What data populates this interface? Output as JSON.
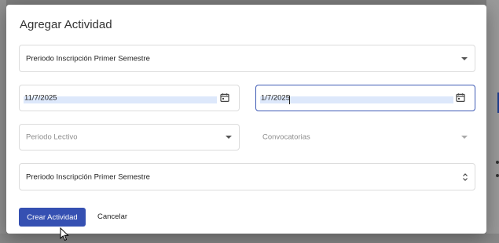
{
  "dialog": {
    "title": "Agregar Actividad",
    "tipo_select": {
      "value": "Preriodo Inscripción Primer Semestre"
    },
    "fecha_inicio": {
      "value": "11/7/2025"
    },
    "fecha_fin": {
      "value": "1/7/2025"
    },
    "periodo_lectivo": {
      "placeholder": "Periodo Lectivo"
    },
    "convocatorias": {
      "placeholder": "Convocatorias"
    },
    "actividad_select": {
      "value": "Preriodo Inscripción Primer Semestre"
    },
    "create_label": "Crear Actividad",
    "cancel_label": "Cancelar"
  },
  "colors": {
    "primary": "#3550b2",
    "focus_border": "#3f5bb5",
    "selection_highlight": "#dde8fb"
  },
  "icons": [
    "calendar-icon",
    "chevron-down-icon",
    "updown-icon",
    "mouse-pointer-icon"
  ]
}
